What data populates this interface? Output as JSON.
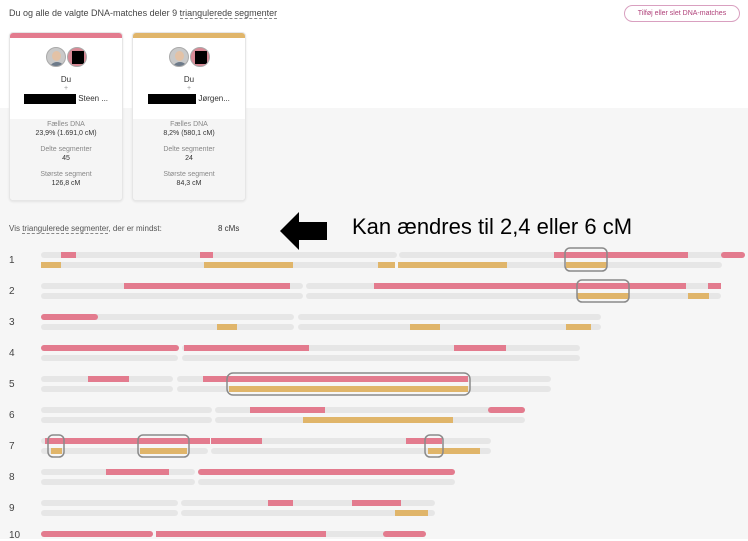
{
  "header": {
    "intro": "Du og alle de valgte DNA-matches deler 9",
    "link": "triangulerede segmenter",
    "button": "Tilføj eller slet DNA-matches"
  },
  "cards": [
    {
      "band_color": "#e37b8e",
      "you": "Du",
      "plus": "+",
      "match_name": "Steen ...",
      "shared_dna_label": "Fælles DNA",
      "shared_dna_value": "23,9% (1.691,0 cM)",
      "segments_label": "Delte segmenter",
      "segments_value": "45",
      "largest_label": "Største segment",
      "largest_value": "126,8 cM"
    },
    {
      "band_color": "#e0b56a",
      "you": "Du",
      "plus": "+",
      "match_name": "Jørgen...",
      "shared_dna_label": "Fælles DNA",
      "shared_dna_value": "8,2% (580,1 cM)",
      "segments_label": "Delte segmenter",
      "segments_value": "24",
      "largest_label": "Største segment",
      "largest_value": "84,3 cM"
    }
  ],
  "filter": {
    "prefix": "Vis",
    "link": "triangulerede segmenter",
    "suffix": ", der er mindst:",
    "value": "8 cMs"
  },
  "annotation": "Kan ændres til 2,4 eller 6 cM",
  "colors": {
    "pink": "#e37b8e",
    "gold": "#e0b56a",
    "track": "#e6e6e6",
    "highlight_border": "#8a8a8a"
  },
  "chromosomes": [
    {
      "label": "1"
    },
    {
      "label": "2"
    },
    {
      "label": "3"
    },
    {
      "label": "4"
    },
    {
      "label": "5"
    },
    {
      "label": "6"
    },
    {
      "label": "7"
    },
    {
      "label": "8"
    },
    {
      "label": "9"
    },
    {
      "label": "10"
    }
  ]
}
